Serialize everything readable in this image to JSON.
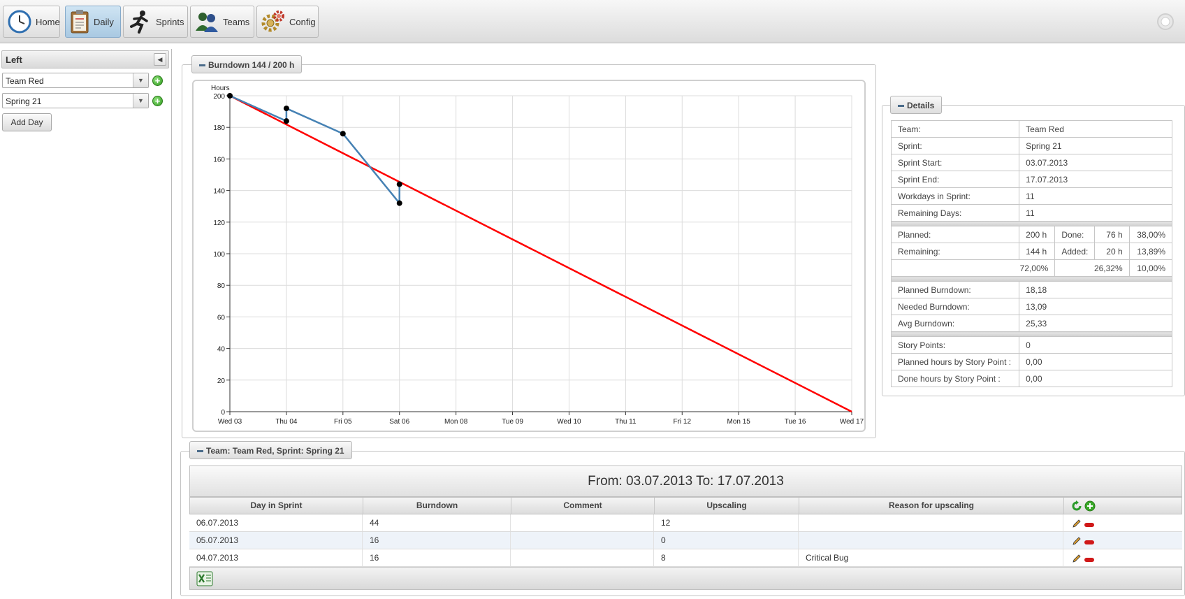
{
  "nav": {
    "tabs": [
      {
        "label": "Home",
        "icon": "clock-icon"
      },
      {
        "label": "Daily",
        "icon": "clipboard-icon",
        "active": true
      },
      {
        "label": "Sprints",
        "icon": "runner-icon"
      },
      {
        "label": "Teams",
        "icon": "people-icon"
      },
      {
        "label": "Config",
        "icon": "gears-icon"
      }
    ]
  },
  "left": {
    "title": "Left",
    "team_select": "Team Red",
    "sprint_select": "Spring 21",
    "add_day_label": "Add Day"
  },
  "burndown": {
    "legend": "Burndown 144 / 200 h"
  },
  "chart_data": {
    "type": "line",
    "ylabel": "Hours",
    "ylim": [
      0,
      200
    ],
    "yticks": [
      0,
      20,
      40,
      60,
      80,
      100,
      120,
      140,
      160,
      180,
      200
    ],
    "xlabels": [
      "Wed 03",
      "Thu 04",
      "Fri 05",
      "Sat 06",
      "Mon 08",
      "Tue 09",
      "Wed 10",
      "Thu 11",
      "Fri 12",
      "Mon 15",
      "Tue 16",
      "Wed 17"
    ],
    "grid": true,
    "ideal_color": "#ff0000",
    "actual_color": "#4682b4",
    "series": [
      {
        "values": [
          [
            0,
            200
          ],
          [
            11,
            0
          ]
        ]
      },
      {
        "values": [
          [
            0,
            200
          ],
          [
            1,
            184
          ],
          [
            1,
            192
          ],
          [
            2,
            176
          ],
          [
            3,
            132
          ],
          [
            3,
            144
          ]
        ]
      }
    ]
  },
  "details": {
    "legend": "Details",
    "info": [
      {
        "label": "Team:",
        "value": "Team Red"
      },
      {
        "label": "Sprint:",
        "value": "Spring 21"
      },
      {
        "label": "Sprint Start:",
        "value": "03.07.2013"
      },
      {
        "label": "Sprint End:",
        "value": "17.07.2013"
      },
      {
        "label": "Workdays in Sprint:",
        "value": "11"
      },
      {
        "label": "Remaining Days:",
        "value": "11"
      }
    ],
    "planned": {
      "label": "Planned:",
      "value": "200 h",
      "label2": "Done:",
      "value2": "76 h",
      "pct": "38,00%"
    },
    "remaining": {
      "label": "Remaining:",
      "value": "144 h",
      "label2": "Added:",
      "value2": "20 h",
      "pct": "13,89%"
    },
    "percents": {
      "a": "72,00%",
      "b": "26,32%",
      "c": "10,00%"
    },
    "burndown": [
      {
        "label": "Planned Burndown:",
        "value": "18,18"
      },
      {
        "label": "Needed Burndown:",
        "value": "13,09"
      },
      {
        "label": "Avg Burndown:",
        "value": "25,33"
      }
    ],
    "story": [
      {
        "label": "Story Points:",
        "value": "0"
      },
      {
        "label": "Planned hours by Story Point :",
        "value": "0,00"
      },
      {
        "label": "Done hours by Story Point :",
        "value": "0,00"
      }
    ]
  },
  "grid": {
    "legend": "Team: Team Red, Sprint: Spring 21",
    "title": "From: 03.07.2013 To: 17.07.2013",
    "columns": [
      "Day in Sprint",
      "Burndown",
      "Comment",
      "Upscaling",
      "Reason for upscaling"
    ],
    "rows": [
      {
        "day": "06.07.2013",
        "burndown": "44",
        "comment": "",
        "upscaling": "12",
        "reason": ""
      },
      {
        "day": "05.07.2013",
        "burndown": "16",
        "comment": "",
        "upscaling": "0",
        "reason": ""
      },
      {
        "day": "04.07.2013",
        "burndown": "16",
        "comment": "",
        "upscaling": "8",
        "reason": "Critical Bug"
      }
    ]
  }
}
